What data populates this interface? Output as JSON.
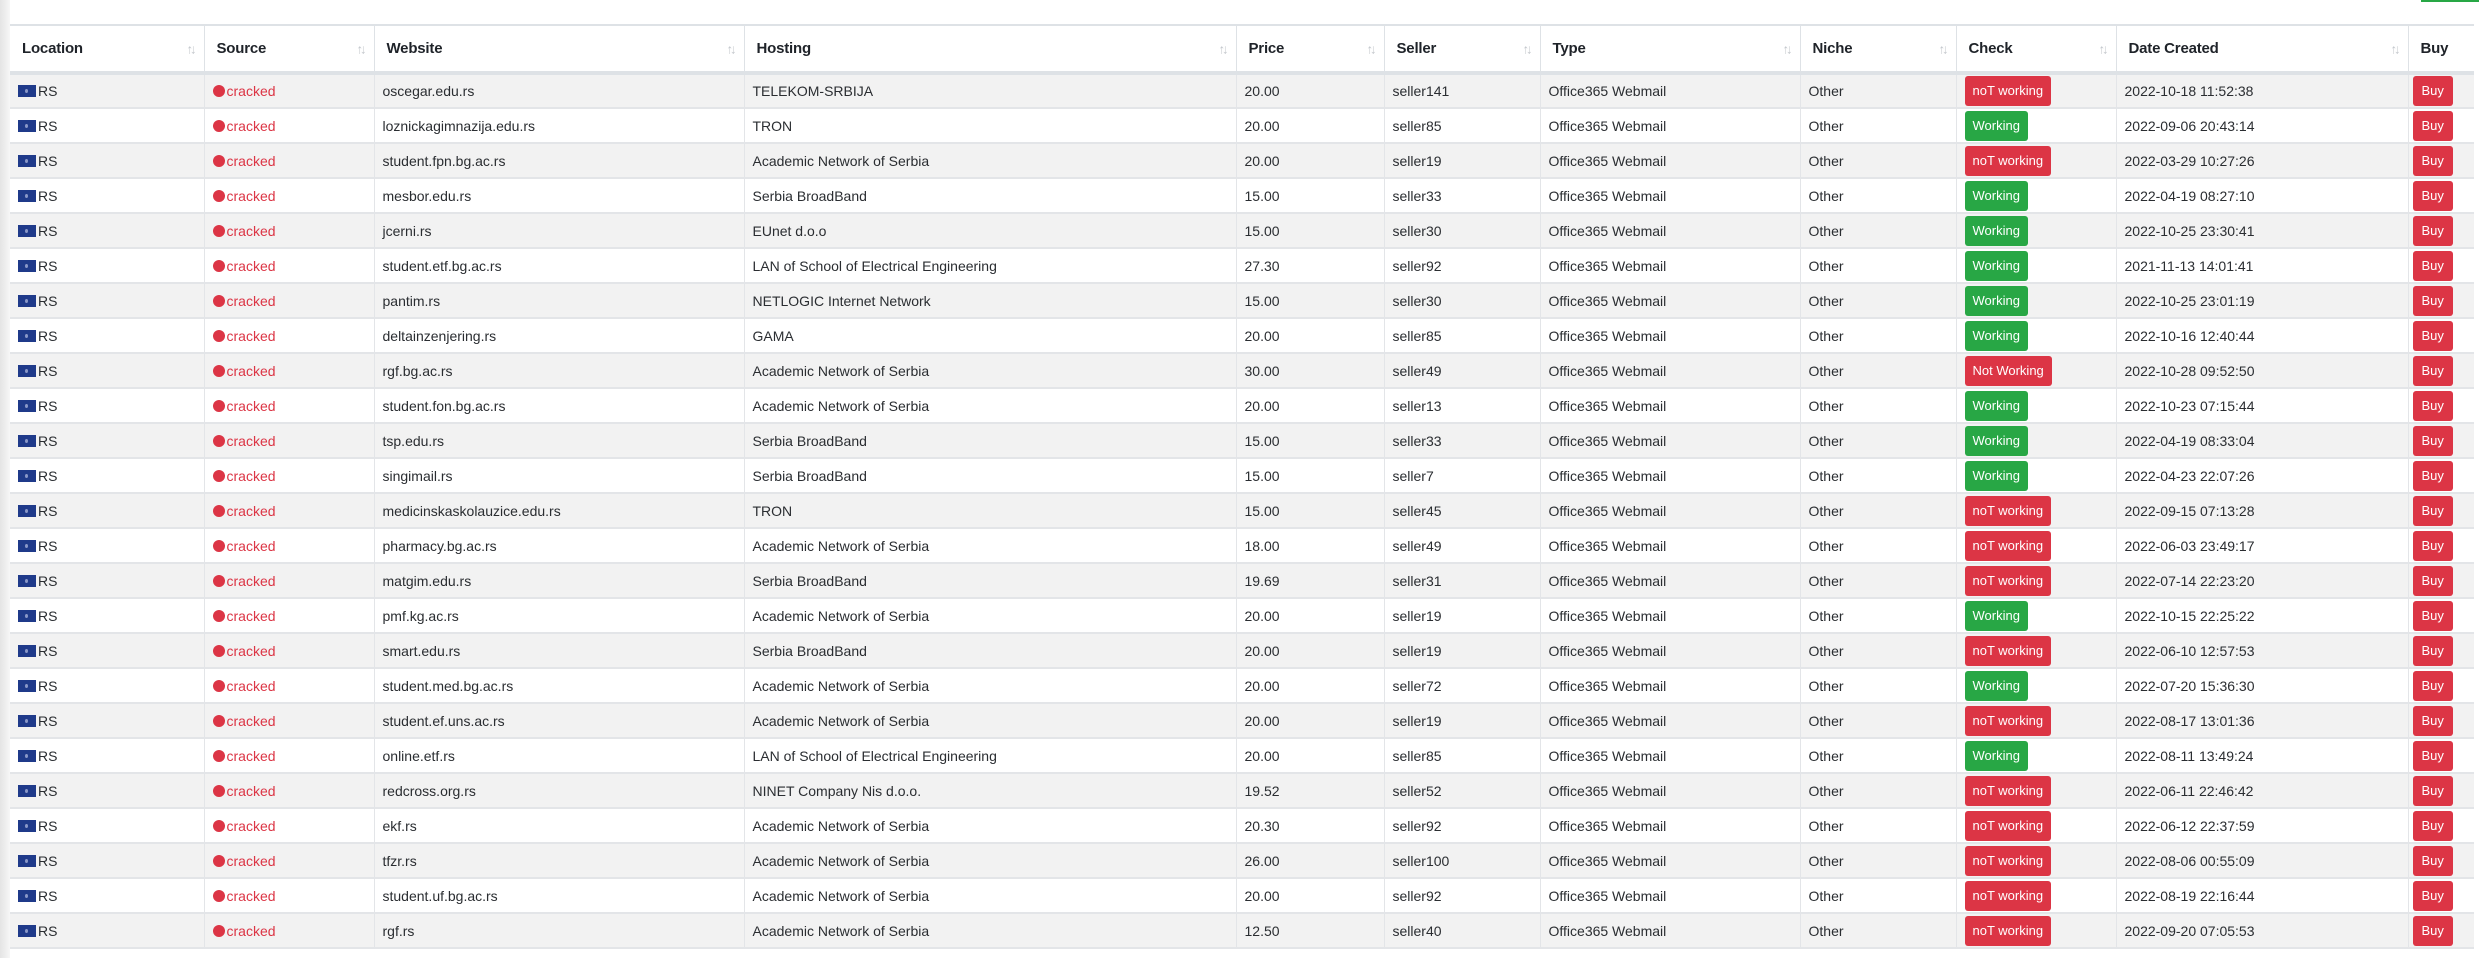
{
  "colors": {
    "working": "#28a745",
    "not_working": "#dc3545",
    "buy": "#dc3545",
    "source_cracked": "#dc3545"
  },
  "table": {
    "columns": [
      {
        "key": "location",
        "label": "Location",
        "sortable": true
      },
      {
        "key": "source",
        "label": "Source",
        "sortable": true
      },
      {
        "key": "website",
        "label": "Website",
        "sortable": true
      },
      {
        "key": "hosting",
        "label": "Hosting",
        "sortable": true
      },
      {
        "key": "price",
        "label": "Price",
        "sortable": true
      },
      {
        "key": "seller",
        "label": "Seller",
        "sortable": true
      },
      {
        "key": "type",
        "label": "Type",
        "sortable": true
      },
      {
        "key": "niche",
        "label": "Niche",
        "sortable": true
      },
      {
        "key": "check",
        "label": "Check",
        "sortable": true
      },
      {
        "key": "date_created",
        "label": "Date Created",
        "sortable": true
      },
      {
        "key": "buy",
        "label": "Buy",
        "sortable": false
      }
    ],
    "sort_icon": "↑↓",
    "buy_label": "Buy",
    "rows": [
      {
        "location": "RS",
        "flag_icon": "serbia-flag-icon",
        "source": "cracked",
        "website": "oscegar.edu.rs",
        "hosting": "TELEKOM-SRBIJA",
        "price": "20.00",
        "seller": "seller141",
        "type": "Office365 Webmail",
        "niche": "Other",
        "check": "noT working",
        "check_status": "bad",
        "date_created": "2022-10-18 11:52:38"
      },
      {
        "location": "RS",
        "flag_icon": "serbia-flag-icon",
        "source": "cracked",
        "website": "loznickagimnazija.edu.rs",
        "hosting": "TRON",
        "price": "20.00",
        "seller": "seller85",
        "type": "Office365 Webmail",
        "niche": "Other",
        "check": "Working",
        "check_status": "ok",
        "date_created": "2022-09-06 20:43:14"
      },
      {
        "location": "RS",
        "flag_icon": "serbia-flag-icon",
        "source": "cracked",
        "website": "student.fpn.bg.ac.rs",
        "hosting": "Academic Network of Serbia",
        "price": "20.00",
        "seller": "seller19",
        "type": "Office365 Webmail",
        "niche": "Other",
        "check": "noT working",
        "check_status": "bad",
        "date_created": "2022-03-29 10:27:26"
      },
      {
        "location": "RS",
        "flag_icon": "serbia-flag-icon",
        "source": "cracked",
        "website": "mesbor.edu.rs",
        "hosting": "Serbia BroadBand",
        "price": "15.00",
        "seller": "seller33",
        "type": "Office365 Webmail",
        "niche": "Other",
        "check": "Working",
        "check_status": "ok",
        "date_created": "2022-04-19 08:27:10"
      },
      {
        "location": "RS",
        "flag_icon": "serbia-flag-icon",
        "source": "cracked",
        "website": "jcerni.rs",
        "hosting": "EUnet d.o.o",
        "price": "15.00",
        "seller": "seller30",
        "type": "Office365 Webmail",
        "niche": "Other",
        "check": "Working",
        "check_status": "ok",
        "date_created": "2022-10-25 23:30:41"
      },
      {
        "location": "RS",
        "flag_icon": "serbia-flag-icon",
        "source": "cracked",
        "website": "student.etf.bg.ac.rs",
        "hosting": "LAN of School of Electrical Engineering",
        "price": "27.30",
        "seller": "seller92",
        "type": "Office365 Webmail",
        "niche": "Other",
        "check": "Working",
        "check_status": "ok",
        "date_created": "2021-11-13 14:01:41"
      },
      {
        "location": "RS",
        "flag_icon": "serbia-flag-icon",
        "source": "cracked",
        "website": "pantim.rs",
        "hosting": "NETLOGIC Internet Network",
        "price": "15.00",
        "seller": "seller30",
        "type": "Office365 Webmail",
        "niche": "Other",
        "check": "Working",
        "check_status": "ok",
        "date_created": "2022-10-25 23:01:19"
      },
      {
        "location": "RS",
        "flag_icon": "serbia-flag-icon",
        "source": "cracked",
        "website": "deltainzenjering.rs",
        "hosting": "GAMA",
        "price": "20.00",
        "seller": "seller85",
        "type": "Office365 Webmail",
        "niche": "Other",
        "check": "Working",
        "check_status": "ok",
        "date_created": "2022-10-16 12:40:44"
      },
      {
        "location": "RS",
        "flag_icon": "serbia-flag-icon",
        "source": "cracked",
        "website": "rgf.bg.ac.rs",
        "hosting": "Academic Network of Serbia",
        "price": "30.00",
        "seller": "seller49",
        "type": "Office365 Webmail",
        "niche": "Other",
        "check": "Not Working",
        "check_status": "bad",
        "date_created": "2022-10-28 09:52:50"
      },
      {
        "location": "RS",
        "flag_icon": "serbia-flag-icon",
        "source": "cracked",
        "website": "student.fon.bg.ac.rs",
        "hosting": "Academic Network of Serbia",
        "price": "20.00",
        "seller": "seller13",
        "type": "Office365 Webmail",
        "niche": "Other",
        "check": "Working",
        "check_status": "ok",
        "date_created": "2022-10-23 07:15:44"
      },
      {
        "location": "RS",
        "flag_icon": "serbia-flag-icon",
        "source": "cracked",
        "website": "tsp.edu.rs",
        "hosting": "Serbia BroadBand",
        "price": "15.00",
        "seller": "seller33",
        "type": "Office365 Webmail",
        "niche": "Other",
        "check": "Working",
        "check_status": "ok",
        "date_created": "2022-04-19 08:33:04"
      },
      {
        "location": "RS",
        "flag_icon": "serbia-flag-icon",
        "source": "cracked",
        "website": "singimail.rs",
        "hosting": "Serbia BroadBand",
        "price": "15.00",
        "seller": "seller7",
        "type": "Office365 Webmail",
        "niche": "Other",
        "check": "Working",
        "check_status": "ok",
        "date_created": "2022-04-23 22:07:26"
      },
      {
        "location": "RS",
        "flag_icon": "serbia-flag-icon",
        "source": "cracked",
        "website": "medicinskaskolauzice.edu.rs",
        "hosting": "TRON",
        "price": "15.00",
        "seller": "seller45",
        "type": "Office365 Webmail",
        "niche": "Other",
        "check": "noT working",
        "check_status": "bad",
        "date_created": "2022-09-15 07:13:28"
      },
      {
        "location": "RS",
        "flag_icon": "serbia-flag-icon",
        "source": "cracked",
        "website": "pharmacy.bg.ac.rs",
        "hosting": "Academic Network of Serbia",
        "price": "18.00",
        "seller": "seller49",
        "type": "Office365 Webmail",
        "niche": "Other",
        "check": "noT working",
        "check_status": "bad",
        "date_created": "2022-06-03 23:49:17"
      },
      {
        "location": "RS",
        "flag_icon": "serbia-flag-icon",
        "source": "cracked",
        "website": "matgim.edu.rs",
        "hosting": "Serbia BroadBand",
        "price": "19.69",
        "seller": "seller31",
        "type": "Office365 Webmail",
        "niche": "Other",
        "check": "noT working",
        "check_status": "bad",
        "date_created": "2022-07-14 22:23:20"
      },
      {
        "location": "RS",
        "flag_icon": "serbia-flag-icon",
        "source": "cracked",
        "website": "pmf.kg.ac.rs",
        "hosting": "Academic Network of Serbia",
        "price": "20.00",
        "seller": "seller19",
        "type": "Office365 Webmail",
        "niche": "Other",
        "check": "Working",
        "check_status": "ok",
        "date_created": "2022-10-15 22:25:22"
      },
      {
        "location": "RS",
        "flag_icon": "serbia-flag-icon",
        "source": "cracked",
        "website": "smart.edu.rs",
        "hosting": "Serbia BroadBand",
        "price": "20.00",
        "seller": "seller19",
        "type": "Office365 Webmail",
        "niche": "Other",
        "check": "noT working",
        "check_status": "bad",
        "date_created": "2022-06-10 12:57:53"
      },
      {
        "location": "RS",
        "flag_icon": "serbia-flag-icon",
        "source": "cracked",
        "website": "student.med.bg.ac.rs",
        "hosting": "Academic Network of Serbia",
        "price": "20.00",
        "seller": "seller72",
        "type": "Office365 Webmail",
        "niche": "Other",
        "check": "Working",
        "check_status": "ok",
        "date_created": "2022-07-20 15:36:30"
      },
      {
        "location": "RS",
        "flag_icon": "serbia-flag-icon",
        "source": "cracked",
        "website": "student.ef.uns.ac.rs",
        "hosting": "Academic Network of Serbia",
        "price": "20.00",
        "seller": "seller19",
        "type": "Office365 Webmail",
        "niche": "Other",
        "check": "noT working",
        "check_status": "bad",
        "date_created": "2022-08-17 13:01:36"
      },
      {
        "location": "RS",
        "flag_icon": "serbia-flag-icon",
        "source": "cracked",
        "website": "online.etf.rs",
        "hosting": "LAN of School of Electrical Engineering",
        "price": "20.00",
        "seller": "seller85",
        "type": "Office365 Webmail",
        "niche": "Other",
        "check": "Working",
        "check_status": "ok",
        "date_created": "2022-08-11 13:49:24"
      },
      {
        "location": "RS",
        "flag_icon": "serbia-flag-icon",
        "source": "cracked",
        "website": "redcross.org.rs",
        "hosting": "NINET Company Nis d.o.o.",
        "price": "19.52",
        "seller": "seller52",
        "type": "Office365 Webmail",
        "niche": "Other",
        "check": "noT working",
        "check_status": "bad",
        "date_created": "2022-06-11 22:46:42"
      },
      {
        "location": "RS",
        "flag_icon": "serbia-flag-icon",
        "source": "cracked",
        "website": "ekf.rs",
        "hosting": "Academic Network of Serbia",
        "price": "20.30",
        "seller": "seller92",
        "type": "Office365 Webmail",
        "niche": "Other",
        "check": "noT working",
        "check_status": "bad",
        "date_created": "2022-06-12 22:37:59"
      },
      {
        "location": "RS",
        "flag_icon": "serbia-flag-icon",
        "source": "cracked",
        "website": "tfzr.rs",
        "hosting": "Academic Network of Serbia",
        "price": "26.00",
        "seller": "seller100",
        "type": "Office365 Webmail",
        "niche": "Other",
        "check": "noT working",
        "check_status": "bad",
        "date_created": "2022-08-06 00:55:09"
      },
      {
        "location": "RS",
        "flag_icon": "serbia-flag-icon",
        "source": "cracked",
        "website": "student.uf.bg.ac.rs",
        "hosting": "Academic Network of Serbia",
        "price": "20.00",
        "seller": "seller92",
        "type": "Office365 Webmail",
        "niche": "Other",
        "check": "noT working",
        "check_status": "bad",
        "date_created": "2022-08-19 22:16:44"
      },
      {
        "location": "RS",
        "flag_icon": "serbia-flag-icon",
        "source": "cracked",
        "website": "rgf.rs",
        "hosting": "Academic Network of Serbia",
        "price": "12.50",
        "seller": "seller40",
        "type": "Office365 Webmail",
        "niche": "Other",
        "check": "noT working",
        "check_status": "bad",
        "date_created": "2022-09-20 07:05:53"
      }
    ]
  }
}
